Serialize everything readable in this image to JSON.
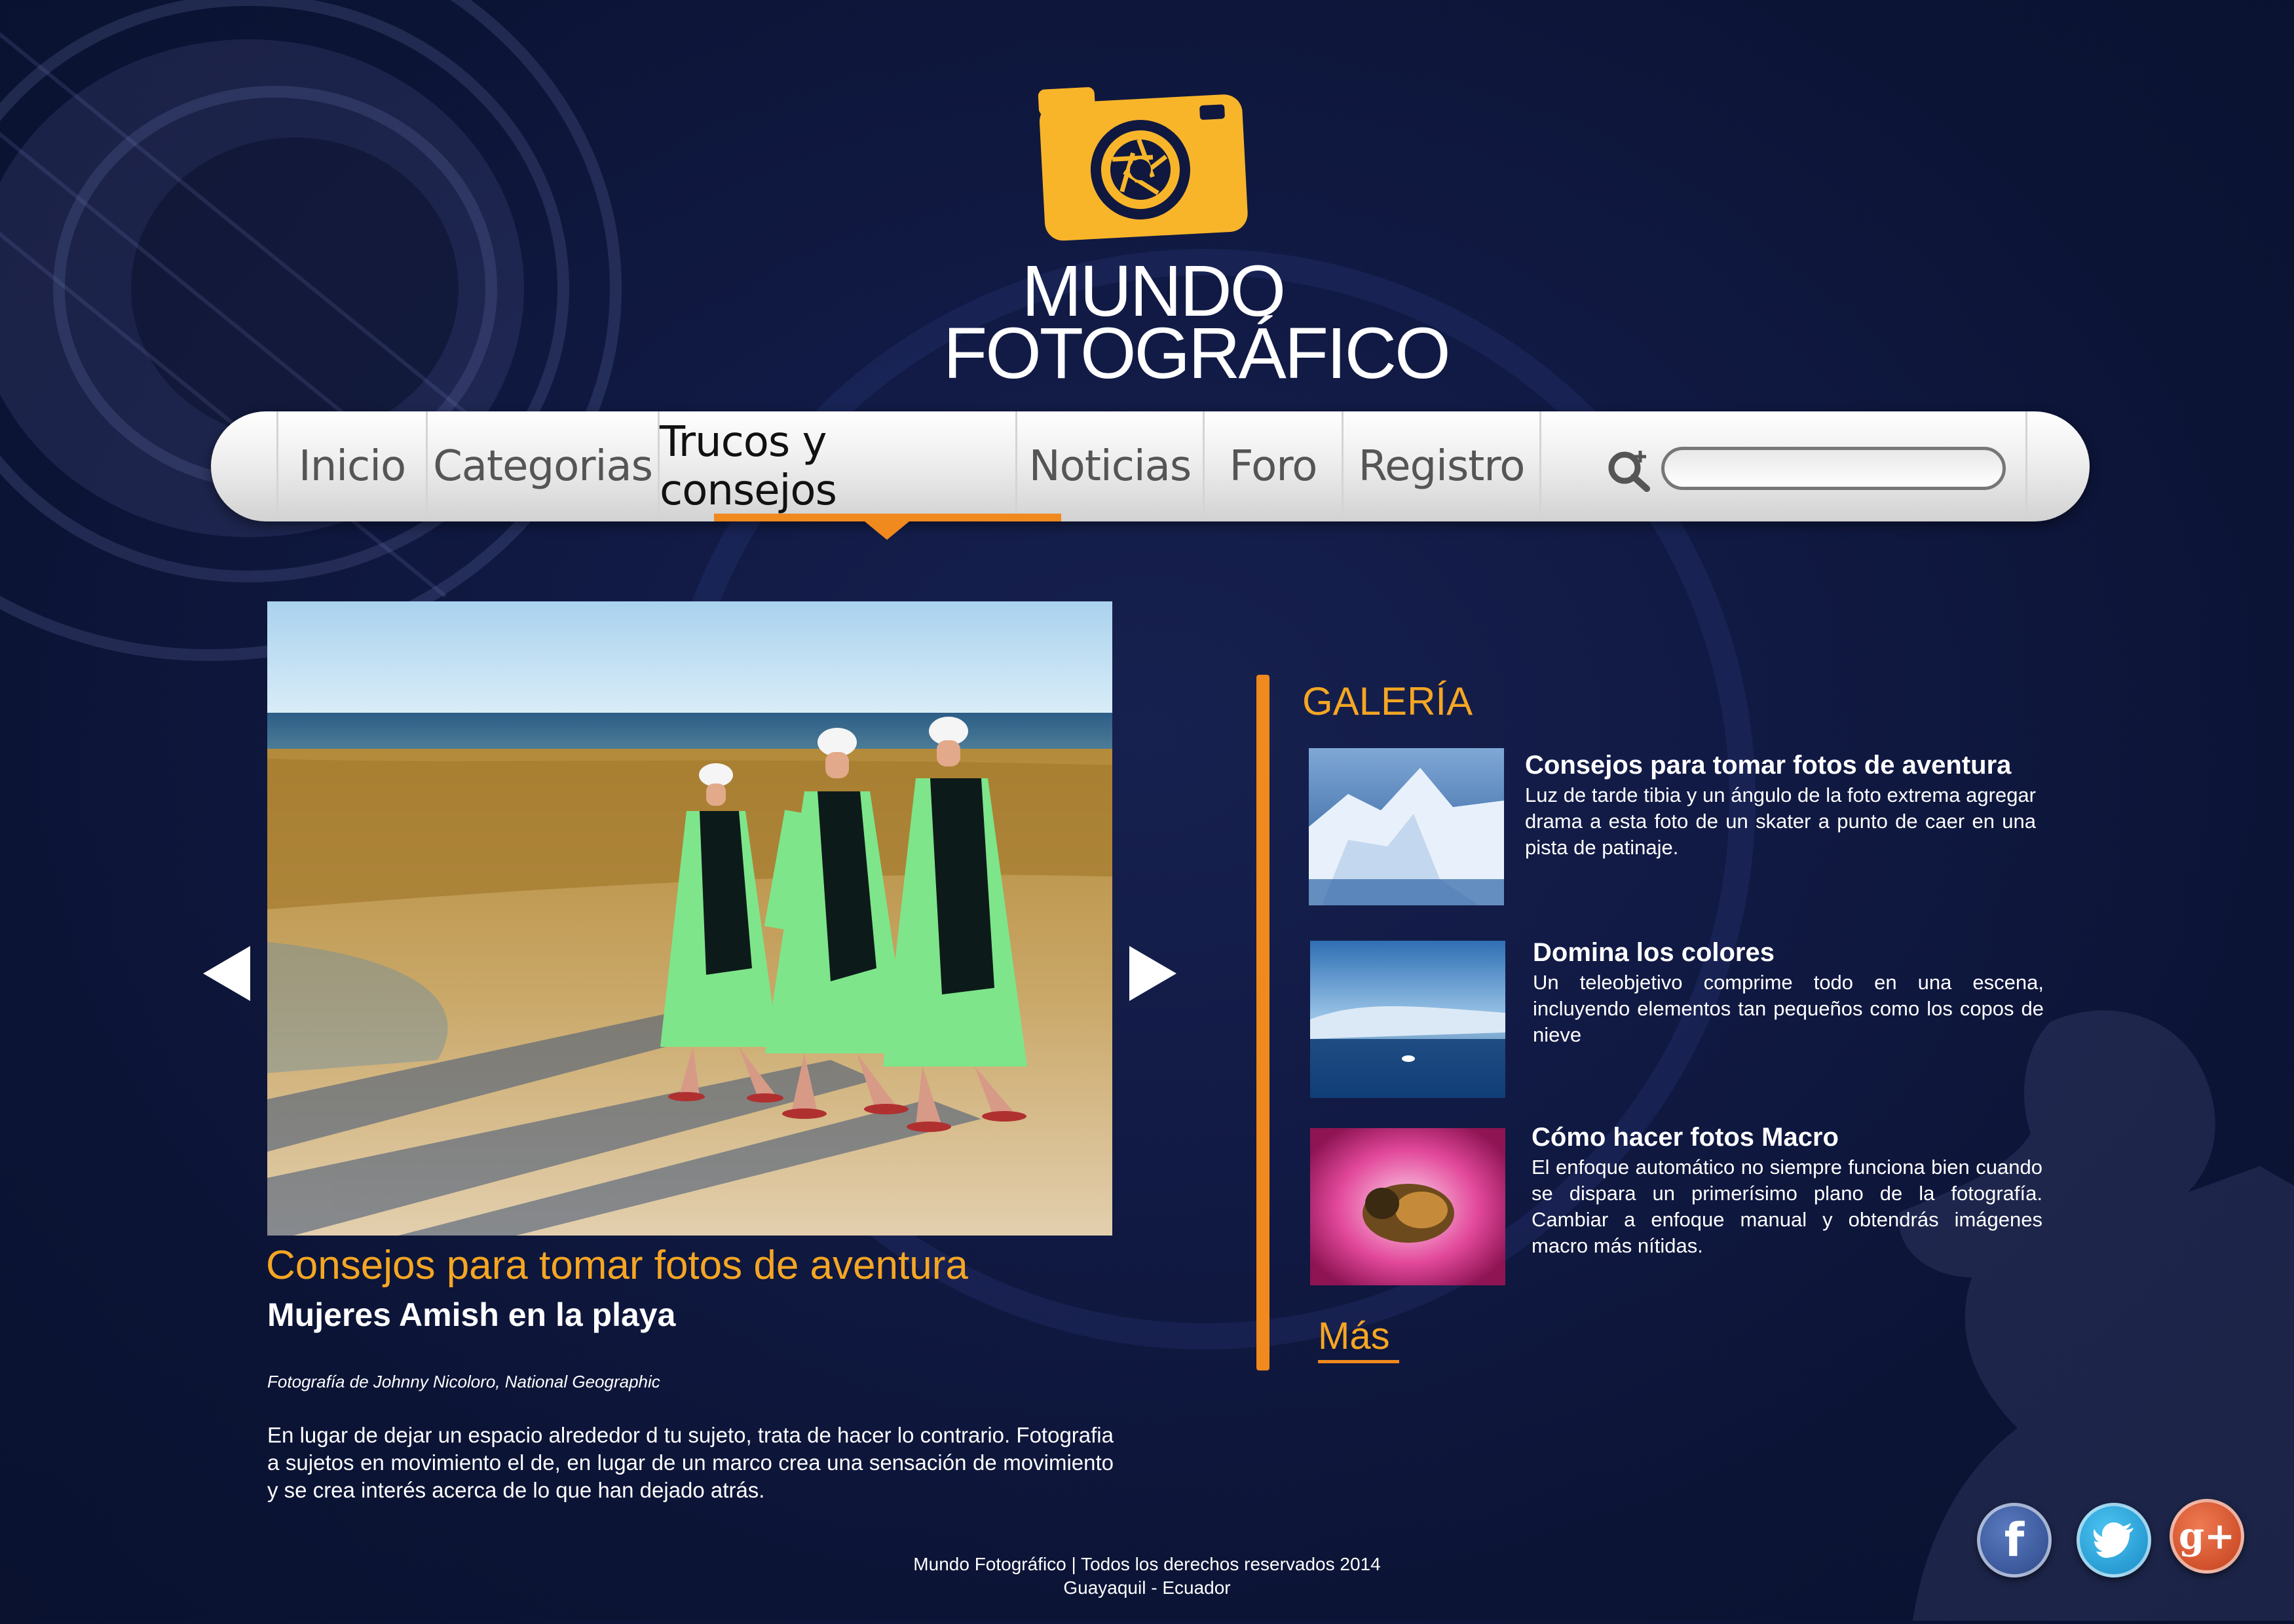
{
  "brand": {
    "line1": "MUNDO",
    "line2": "FOTOGRÁFICO"
  },
  "nav": {
    "items": [
      {
        "label": "Inicio"
      },
      {
        "label": "Categorias"
      },
      {
        "label": "Trucos y consejos",
        "active": true
      },
      {
        "label": "Noticias"
      },
      {
        "label": "Foro"
      },
      {
        "label": "Registro"
      }
    ],
    "search_placeholder": ""
  },
  "featured": {
    "title": "Consejos para tomar fotos de aventura",
    "subtitle": "Mujeres Amish en la playa",
    "credit": "Fotografía de Johnny Nicoloro, National Geographic",
    "body": "En lugar de dejar un espacio alrededor d tu sujeto, trata de hacer lo contrario. Fotografia a sujetos en movimiento el de, en lugar de un marco crea una sensación de movimiento y se crea interés acerca de lo que han dejado atrás."
  },
  "gallery": {
    "title": "GALERÍA",
    "items": [
      {
        "title": "Consejos para tomar fotos de aventura",
        "desc": "Luz de tarde tibia y un ángulo de la foto extrema agregar drama a esta foto de un skater a punto de caer en una pista de patinaje."
      },
      {
        "title": "Domina los colores",
        "desc": "Un teleobjetivo comprime todo en una escena, incluyendo elementos tan pequeños como los copos de nieve"
      },
      {
        "title": "Cómo hacer fotos Macro",
        "desc": "El enfoque automático no siempre funciona bien cuando se dispara un primerísimo plano de la fotografía. Cambiar a enfoque manual y obtendrás imágenes macro más nítidas."
      }
    ],
    "more": "Más"
  },
  "social": [
    {
      "name": "facebook-icon",
      "glyph": "f",
      "color": "#3b5a9a"
    },
    {
      "name": "twitter-icon",
      "glyph": "t",
      "color": "#2aa9e0"
    },
    {
      "name": "google-plus-icon",
      "glyph": "g+",
      "color": "#d9562d"
    }
  ],
  "footer": {
    "line1": "Mundo Fotográfico | Todos los derechos reservados 2014",
    "line2": "Guayaquil - Ecuador"
  },
  "colors": {
    "accent": "#f0891e",
    "gold": "#f5a623",
    "background": "#0f1840"
  }
}
